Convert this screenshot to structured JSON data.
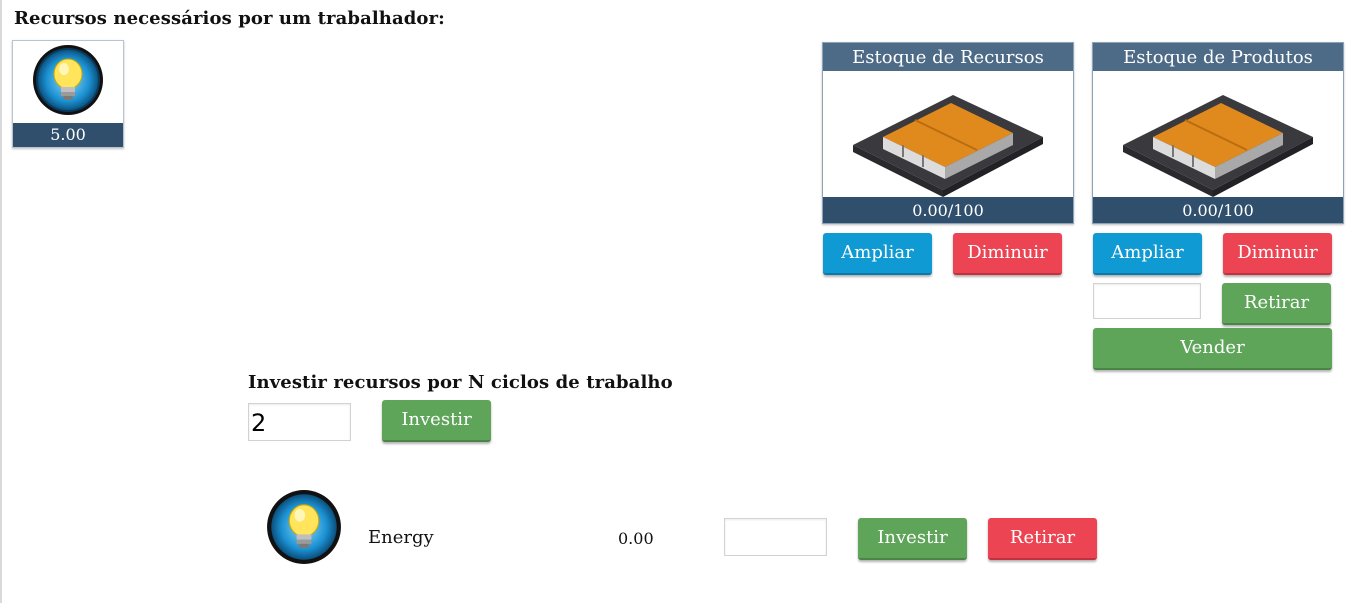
{
  "workers": {
    "heading": "Recursos necessários por um trabalhador:",
    "resource_icon": "lightbulb-icon",
    "resource_amount": "5.00"
  },
  "resource_stock": {
    "title": "Estoque de Recursos",
    "image": "warehouse-icon",
    "capacity": "0.00/100",
    "expand_label": "Ampliar",
    "reduce_label": "Diminuir"
  },
  "product_stock": {
    "title": "Estoque de Produtos",
    "image": "warehouse-icon",
    "capacity": "0.00/100",
    "expand_label": "Ampliar",
    "reduce_label": "Diminuir",
    "withdraw_input_value": "",
    "withdraw_label": "Retirar",
    "sell_label": "Vender"
  },
  "invest_cycles": {
    "heading": "Investir recursos por N ciclos de trabalho",
    "cycles_value": "2",
    "invest_label": "Investir"
  },
  "resource_row": {
    "icon": "lightbulb-icon",
    "name": "Energy",
    "amount": "0.00",
    "input_value": "",
    "invest_label": "Investir",
    "withdraw_label": "Retirar"
  },
  "colors": {
    "blue": "#0f9ad3",
    "red": "#ec4452",
    "green": "#5ea55a",
    "navy": "#2f4f6d",
    "panel_header": "#4d6a86"
  }
}
